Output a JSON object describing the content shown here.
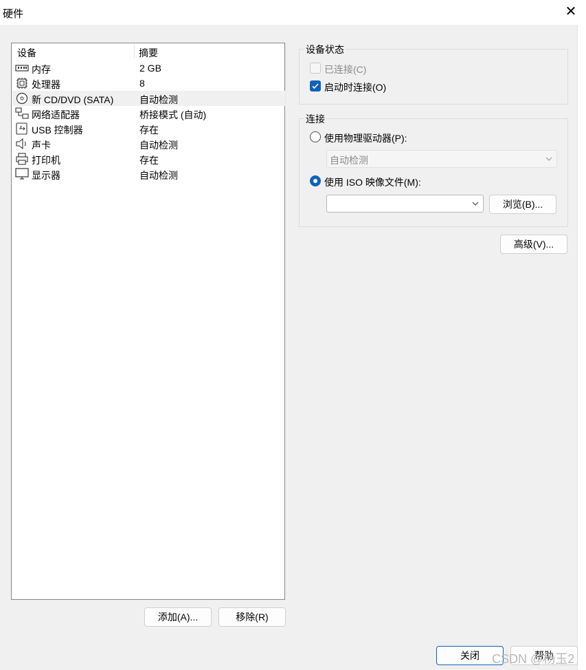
{
  "window": {
    "title": "硬件",
    "close_glyph": "✕"
  },
  "device_list": {
    "columns": [
      "设备",
      "摘要"
    ],
    "rows": [
      {
        "icon": "memory-icon",
        "name": "内存",
        "summary": "2 GB",
        "selected": false
      },
      {
        "icon": "processor-icon",
        "name": "处理器",
        "summary": "8",
        "selected": false
      },
      {
        "icon": "cd-dvd-icon",
        "name": "新 CD/DVD (SATA)",
        "summary": "自动检测",
        "selected": true
      },
      {
        "icon": "network-adapter-icon",
        "name": "网络适配器",
        "summary": "桥接模式 (自动)",
        "selected": false
      },
      {
        "icon": "usb-icon",
        "name": "USB 控制器",
        "summary": "存在",
        "selected": false
      },
      {
        "icon": "sound-card-icon",
        "name": "声卡",
        "summary": "自动检测",
        "selected": false
      },
      {
        "icon": "printer-icon",
        "name": "打印机",
        "summary": "存在",
        "selected": false
      },
      {
        "icon": "display-icon",
        "name": "显示器",
        "summary": "自动检测",
        "selected": false
      }
    ]
  },
  "buttons": {
    "add": "添加(A)...",
    "remove": "移除(R)",
    "browse": "浏览(B)...",
    "advanced": "高级(V)...",
    "close": "关闭",
    "help": "帮助"
  },
  "device_status": {
    "title": "设备状态",
    "connected": {
      "label": "已连接(C)",
      "checked": false,
      "enabled": false
    },
    "connect_at_power_on": {
      "label": "启动时连接(O)",
      "checked": true,
      "enabled": true
    }
  },
  "connection": {
    "title": "连接",
    "physical_drive": {
      "label": "使用物理驱动器(P):",
      "selected": false,
      "combo_value": "自动检测"
    },
    "iso_image": {
      "label": "使用 ISO 映像文件(M):",
      "selected": true,
      "path_value": ""
    }
  },
  "watermark": "CSDN @杨玉2",
  "colors": {
    "accent": "#0f62be",
    "dialog_bg": "#f0f0f0",
    "list_border": "#828790"
  }
}
